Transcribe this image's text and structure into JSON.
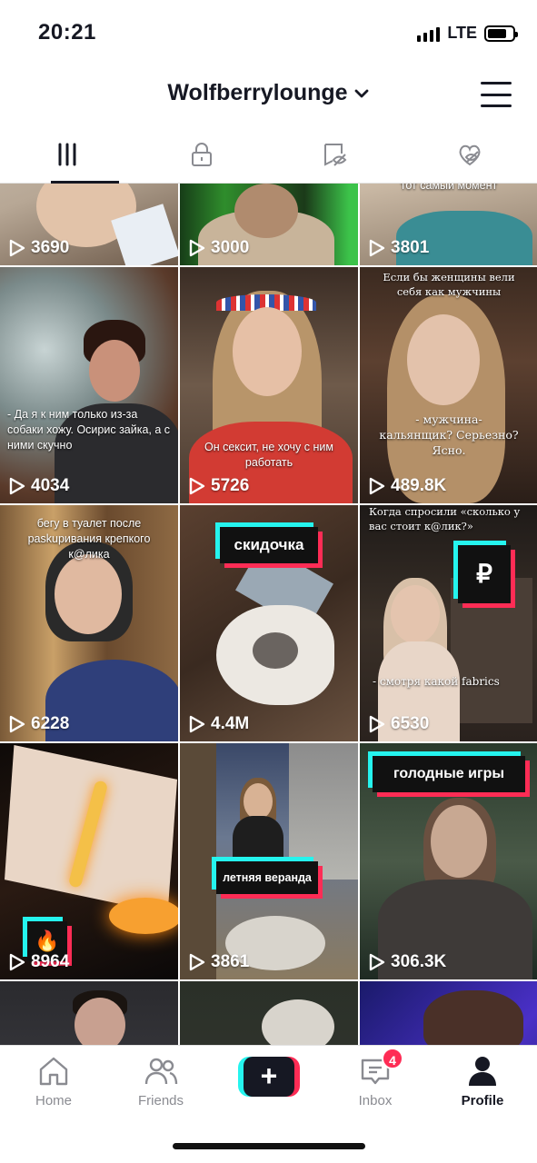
{
  "status_bar": {
    "time": "20:21",
    "network": "LTE"
  },
  "header": {
    "username": "Wolfberrylounge"
  },
  "tabs": [
    {
      "name": "videos",
      "icon": "grid-icon",
      "active": true
    },
    {
      "name": "private",
      "icon": "lock-icon",
      "active": false
    },
    {
      "name": "hidden",
      "icon": "eye-slash-icon",
      "active": false
    },
    {
      "name": "liked",
      "icon": "heart-hidden-icon",
      "active": false
    }
  ],
  "videos": [
    {
      "views": "3690",
      "caption": ""
    },
    {
      "views": "3000",
      "caption": ""
    },
    {
      "views": "3801",
      "caption": "тот самый момент"
    },
    {
      "views": "4034",
      "caption": "- Да я к ним только из-за собаки хожу. Осирис зайка, а с ними скучно"
    },
    {
      "views": "5726",
      "caption": "Он сексит, не хочу с ним работать"
    },
    {
      "views": "489.8K",
      "caption_top": "Если бы женщины вели себя как мужчины",
      "caption": "- мужчина- кальянщик? Серьезно? Ясно."
    },
    {
      "views": "6228",
      "caption": "бегу в туалет после paskuривания крепкого к@лика"
    },
    {
      "views": "4.4M",
      "caption": "скидочка"
    },
    {
      "views": "6530",
      "caption_top": "Когда спросили «сколько у вас стоит к@лик?»",
      "caption": "- смотря какой fabrics",
      "sticker": "₽"
    },
    {
      "views": "8964",
      "caption": "🔥"
    },
    {
      "views": "3861",
      "caption": "летняя веранда"
    },
    {
      "views": "306.3K",
      "caption": "голодные игры"
    }
  ],
  "nav": {
    "home": "Home",
    "friends": "Friends",
    "create": "+",
    "inbox": "Inbox",
    "inbox_badge": "4",
    "profile": "Profile"
  },
  "colors": {
    "accent_cyan": "#25f4ee",
    "accent_red": "#fe2c55",
    "text": "#161823"
  }
}
